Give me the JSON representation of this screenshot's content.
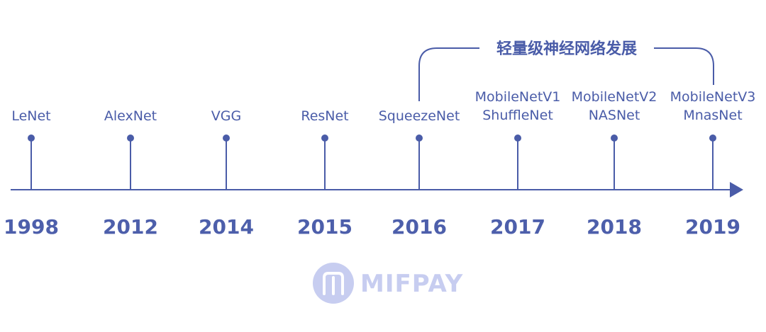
{
  "colors": {
    "line": "#4a5ca8",
    "text": "#4a5ca8",
    "watermark": "#c7cdf0"
  },
  "bracket": {
    "title": "轻量级神经网络发展"
  },
  "events": [
    {
      "year": "1998",
      "labels": [
        "LeNet"
      ]
    },
    {
      "year": "2012",
      "labels": [
        "AlexNet"
      ]
    },
    {
      "year": "2014",
      "labels": [
        "VGG"
      ]
    },
    {
      "year": "2015",
      "labels": [
        "ResNet"
      ]
    },
    {
      "year": "2016",
      "labels": [
        "SqueezeNet"
      ]
    },
    {
      "year": "2017",
      "labels": [
        "MobileNetV1",
        "ShuffleNet"
      ]
    },
    {
      "year": "2018",
      "labels": [
        "MobileNetV2",
        "NASNet"
      ]
    },
    {
      "year": "2019",
      "labels": [
        "MobileNetV3",
        "MnasNet"
      ]
    }
  ],
  "watermark": {
    "text": "MIFPAY",
    "icon": "mifpay-logo-icon"
  }
}
